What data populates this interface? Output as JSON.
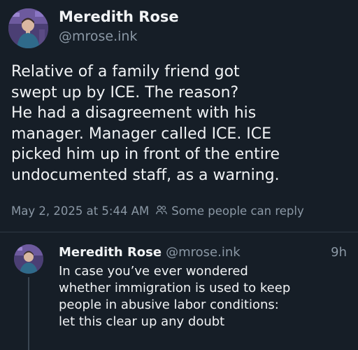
{
  "post": {
    "author_name": "Meredith Rose",
    "author_handle": "@mrose.ink",
    "text_lines": [
      "Relative of a family friend got",
      "swept up by ICE. The reason?",
      "He had a disagreement with his",
      "manager. Manager called ICE. ICE",
      "picked him up in front of the entire",
      "undocumented staff, as a  warning."
    ],
    "timestamp": "May 2, 2025 at 5:44 AM",
    "reply_setting": "Some people can reply",
    "reply_icon": "people-icon"
  },
  "reply": {
    "author_name": "Meredith Rose",
    "author_handle": "@mrose.ink",
    "time_ago": "9h",
    "text_lines": [
      "In case you’ve ever wondered",
      "whether immigration is used to keep",
      "people in abusive labor conditions:",
      "let this clear up any doubt"
    ]
  },
  "colors": {
    "background": "#161e27",
    "text_primary": "#f1f3f5",
    "text_secondary": "#8b98a5",
    "divider": "#2e3944"
  }
}
